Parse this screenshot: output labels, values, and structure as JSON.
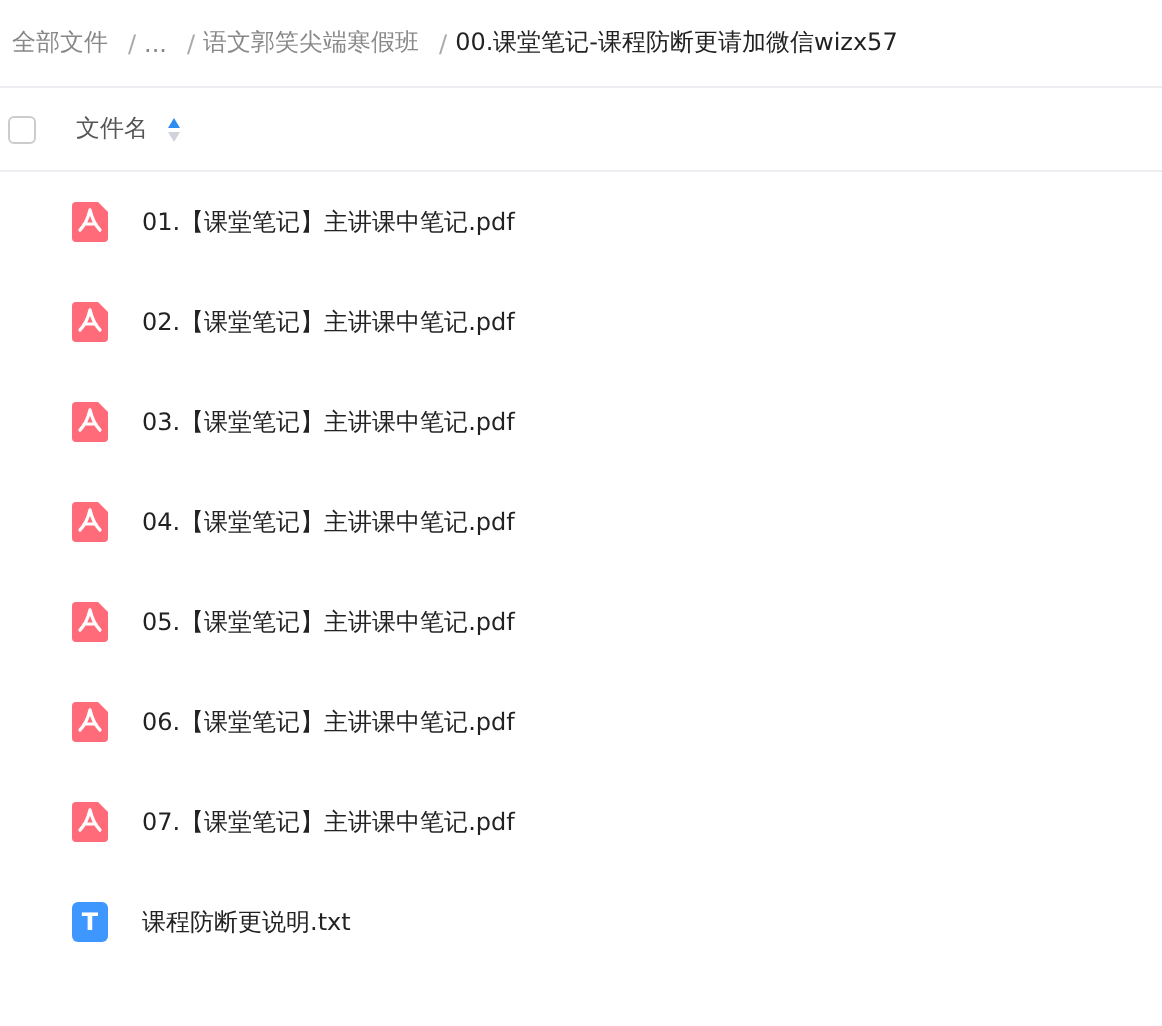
{
  "breadcrumb": [
    {
      "label": "全部文件",
      "current": false
    },
    {
      "separator": "/",
      "label": "...",
      "current": false
    },
    {
      "separator": "/",
      "label": "语文郭笑尖端寒假班",
      "current": false
    },
    {
      "separator": "/",
      "label": "00.课堂笔记-课程防断更请加微信wizx57",
      "current": true
    }
  ],
  "header": {
    "select_all_checked": false,
    "column": "文件名"
  },
  "files": [
    {
      "kind": "pdf",
      "name": "01.【课堂笔记】主讲课中笔记.pdf"
    },
    {
      "kind": "pdf",
      "name": "02.【课堂笔记】主讲课中笔记.pdf"
    },
    {
      "kind": "pdf",
      "name": "03.【课堂笔记】主讲课中笔记.pdf"
    },
    {
      "kind": "pdf",
      "name": "04.【课堂笔记】主讲课中笔记.pdf"
    },
    {
      "kind": "pdf",
      "name": "05.【课堂笔记】主讲课中笔记.pdf"
    },
    {
      "kind": "pdf",
      "name": "06.【课堂笔记】主讲课中笔记.pdf"
    },
    {
      "kind": "pdf",
      "name": "07.【课堂笔记】主讲课中笔记.pdf"
    },
    {
      "kind": "txt",
      "icon_letter": "T",
      "name": "课程防断更说明.txt"
    }
  ]
}
